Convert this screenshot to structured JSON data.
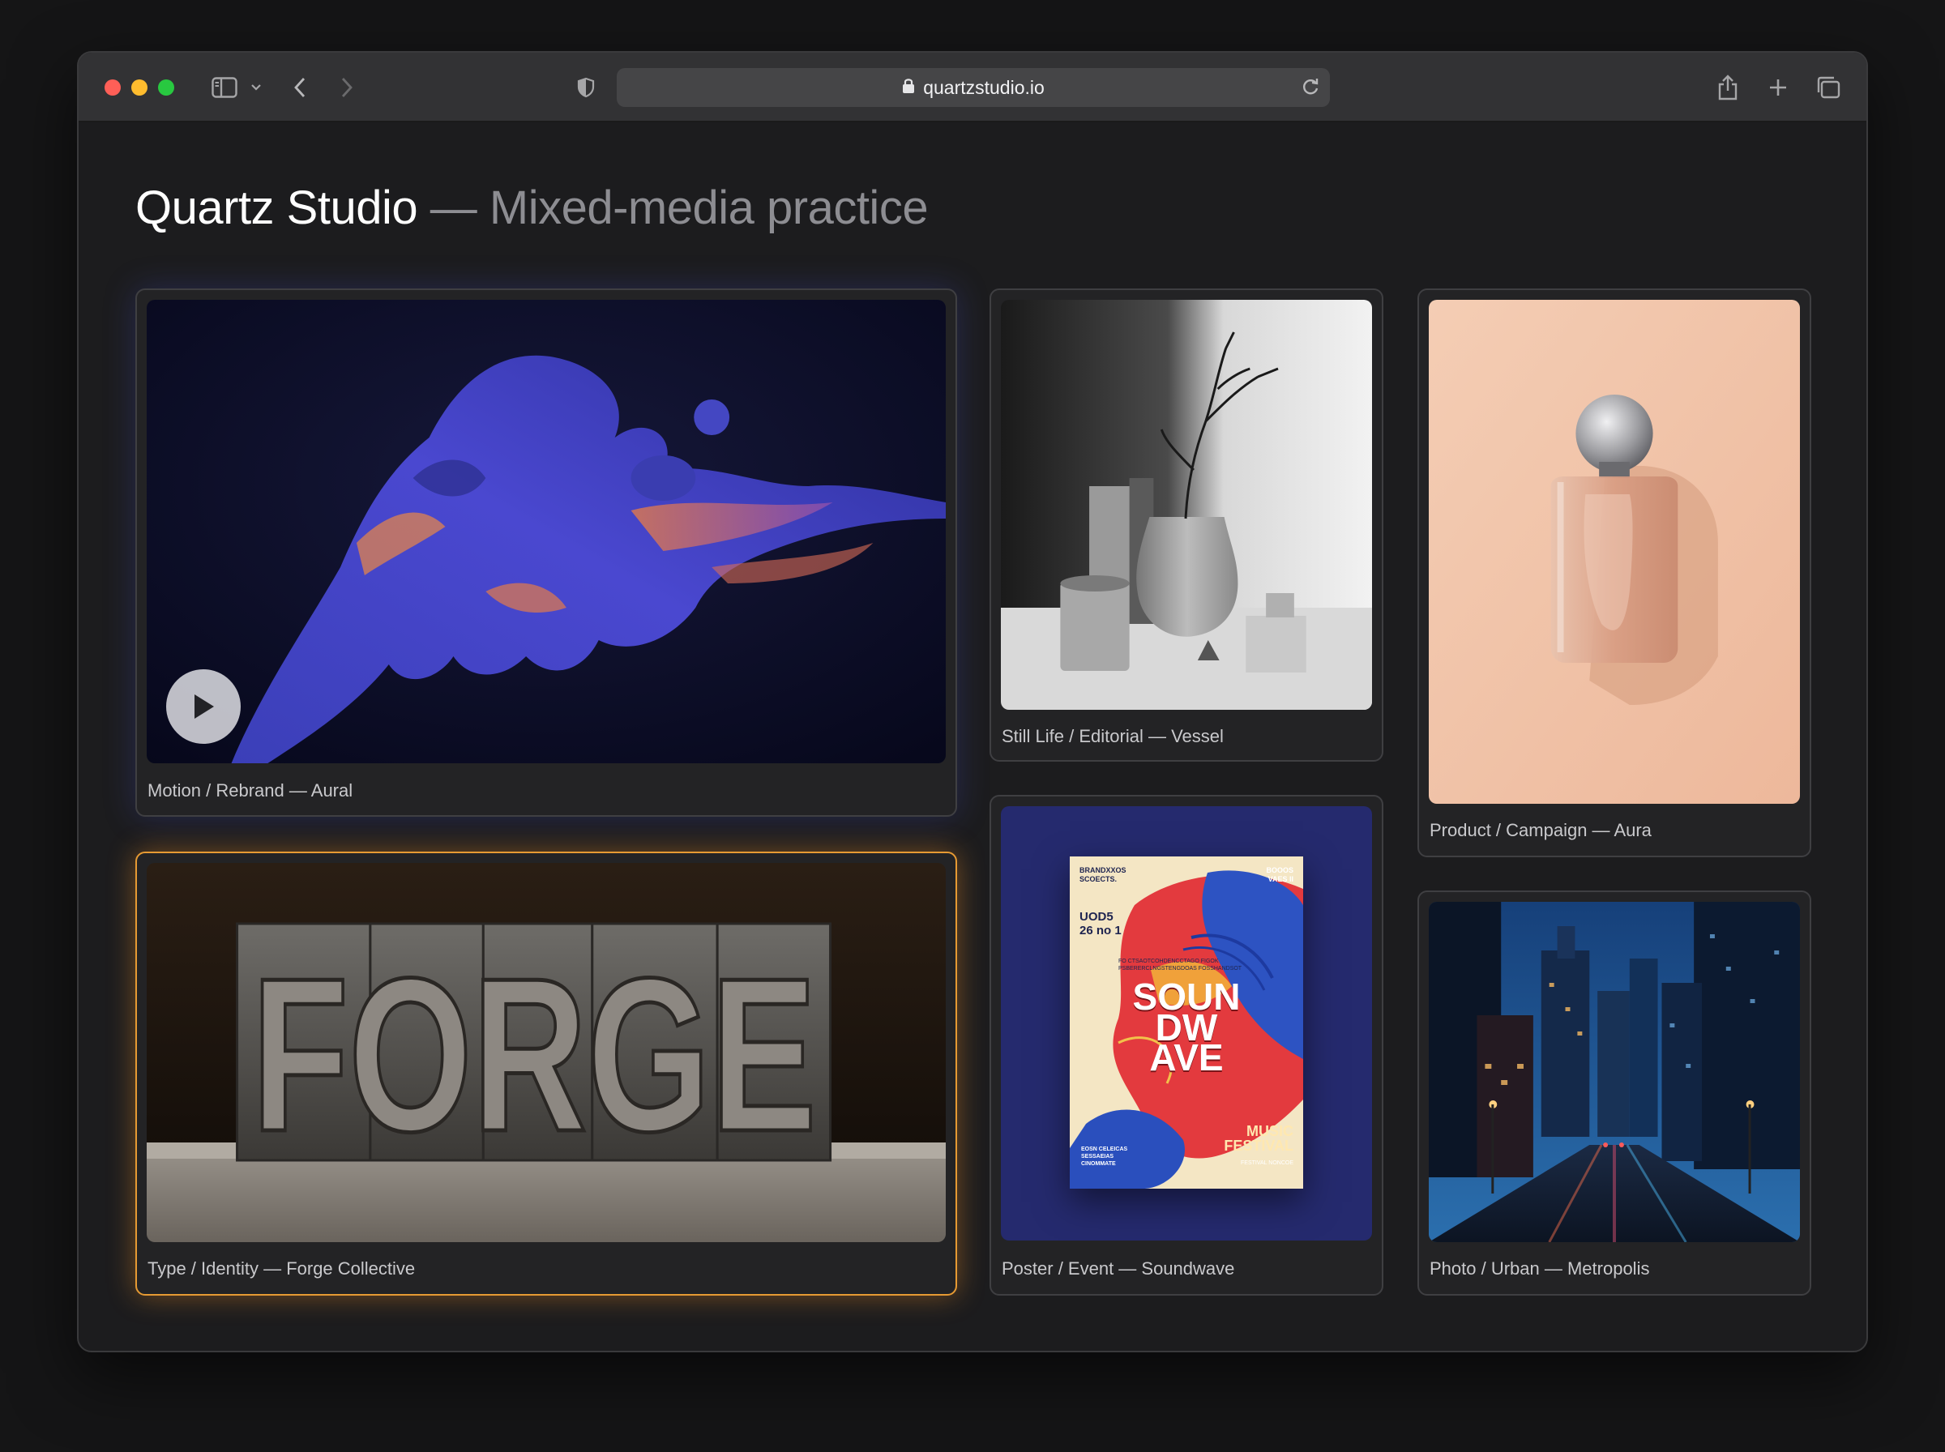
{
  "browser": {
    "url": "quartzstudio.io",
    "icons": [
      "sidebar-icon",
      "chevron-down-icon",
      "back-icon",
      "forward-icon",
      "shield-icon",
      "lock-icon",
      "reload-icon",
      "share-icon",
      "new-tab-icon",
      "tabs-overview-icon"
    ]
  },
  "page": {
    "title_main": "Quartz Studio",
    "title_rest": "— Mixed-media practice"
  },
  "projects": [
    {
      "id": "aural",
      "caption": "Motion / Rebrand — Aural",
      "has_play": true
    },
    {
      "id": "vessel",
      "caption": "Still Life / Editorial — Vessel"
    },
    {
      "id": "aura",
      "caption": "Product / Campaign — Aura"
    },
    {
      "id": "forge",
      "caption": "Type / Identity — Forge Collective",
      "active": true,
      "image_text": "FORGE"
    },
    {
      "id": "soundwave",
      "caption": "Poster / Event — Soundwave",
      "poster": {
        "top_left": "BRANDXXOS SCOECTS.",
        "top_right": "BOOOS VAES II",
        "date": "UOD5 26 no 1",
        "line": "FO CTSAOTCOHDENCCTAGO FIGOK PSBERERCLNGSTENGDOAS FOSSHANDSOT",
        "headline": [
          "SOUN",
          "DW",
          "AVE"
        ],
        "tag": "MUSIC FESTIVAL",
        "tag_small": "FESTIVAL NONCOE",
        "bottom_left": "EOSN CELEICAS SESSAEIAS CINOMMATE"
      }
    },
    {
      "id": "metropolis",
      "caption": "Photo / Urban — Metropolis"
    }
  ],
  "colors": {
    "accent_active": "#e69a33",
    "background": "#151516"
  }
}
